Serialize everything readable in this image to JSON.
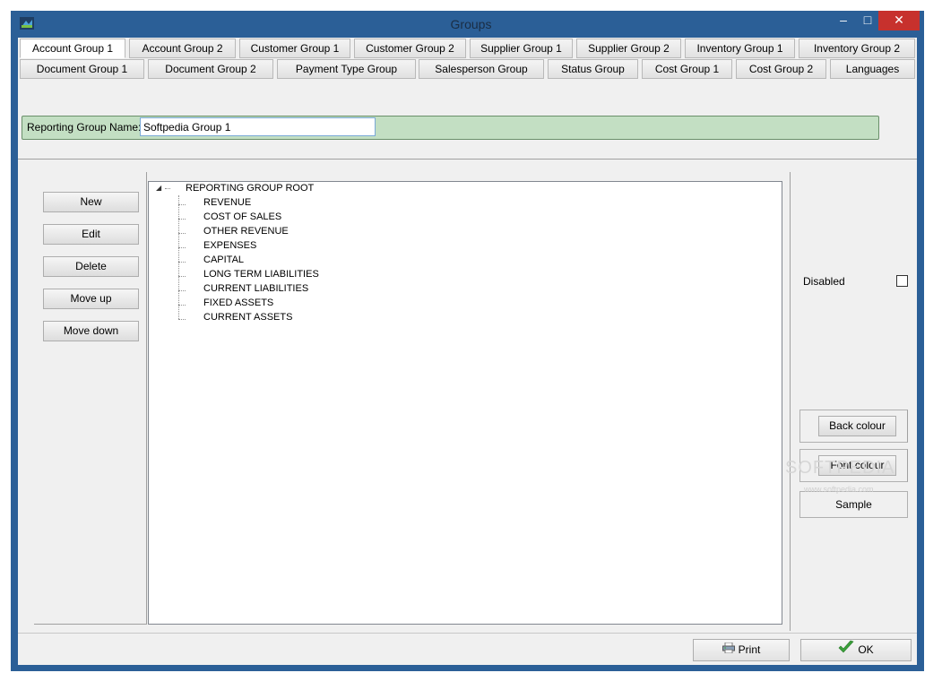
{
  "window": {
    "title": "Groups",
    "minimize": "–",
    "maximize": "□",
    "close": "✕"
  },
  "tabs_row1": [
    "Account Group 1",
    "Account Group 2",
    "Customer Group 1",
    "Customer Group 2",
    "Supplier Group 1",
    "Supplier Group 2",
    "Inventory Group 1",
    "Inventory Group 2"
  ],
  "tabs_row2": [
    "Document Group 1",
    "Document Group 2",
    "Payment Type Group",
    "Salesperson Group",
    "Status Group",
    "Cost Group 1",
    "Cost Group 2",
    "Languages"
  ],
  "active_tab": "Account Group 1",
  "reporting": {
    "label": "Reporting Group Name:",
    "value": "Softpedia Group 1"
  },
  "left_buttons": {
    "new": "New",
    "edit": "Edit",
    "delete": "Delete",
    "move_up": "Move up",
    "move_down": "Move down"
  },
  "tree": {
    "root": "REPORTING GROUP ROOT",
    "items": [
      "REVENUE",
      "COST OF SALES",
      "OTHER REVENUE",
      "EXPENSES",
      "CAPITAL",
      "LONG TERM LIABILITIES",
      "CURRENT LIABILITIES",
      "FIXED ASSETS",
      "CURRENT ASSETS"
    ]
  },
  "right_panel": {
    "disabled_label": "Disabled",
    "back_colour": "Back colour",
    "font_colour": "Font colour",
    "sample": "Sample"
  },
  "watermark": {
    "main": "SOFTPEDIA",
    "sub": "www.softpedia.com"
  },
  "footer": {
    "print": "Print",
    "ok": "OK"
  },
  "colors": {
    "window_frame": "#2b5f97",
    "name_panel": "#c3dfc3",
    "close_button": "#c7312d",
    "ok_check": "#3aa13a"
  },
  "icons": {
    "app": "app-icon",
    "print": "printer-icon",
    "ok": "checkmark-icon"
  }
}
